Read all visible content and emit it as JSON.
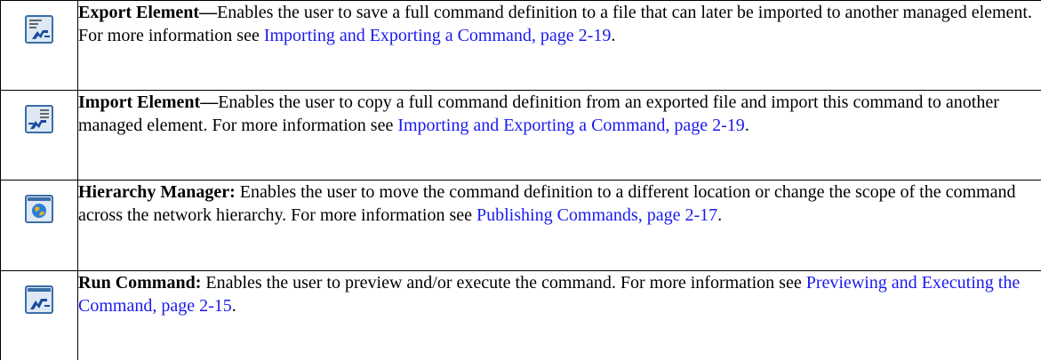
{
  "rows": [
    {
      "icon": "export-element-icon",
      "term": "Export Element—",
      "desc": "Enables the user to save a full command definition to a file that can later be imported to another managed element. For more information see ",
      "link": "Importing and Exporting a Command, page 2-19",
      "end": "."
    },
    {
      "icon": "import-element-icon",
      "term": "Import Element—",
      "desc": "Enables the user to copy a full command definition from an exported file and import this command to another managed element. For more information see ",
      "link": "Importing and Exporting a Command, page 2-19",
      "end": "."
    },
    {
      "icon": "hierarchy-manager-icon",
      "term": "Hierarchy Manager:",
      "desc": " Enables the user to move the command definition to a different location or change the scope of the command across the network hierarchy. For more information see ",
      "link": "Publishing Commands, page 2-17",
      "end": "."
    },
    {
      "icon": "run-command-icon",
      "term": "Run Command:",
      "desc": " Enables the user to preview and/or execute the command. For more information see ",
      "link": "Previewing and Executing the Command, page 2-15",
      "end": "."
    }
  ],
  "colors": {
    "link": "#1a1aee",
    "icon_border": "#3a6ea5",
    "icon_bg": "#dde8f4",
    "icon_glyph": "#1b4aa0"
  }
}
